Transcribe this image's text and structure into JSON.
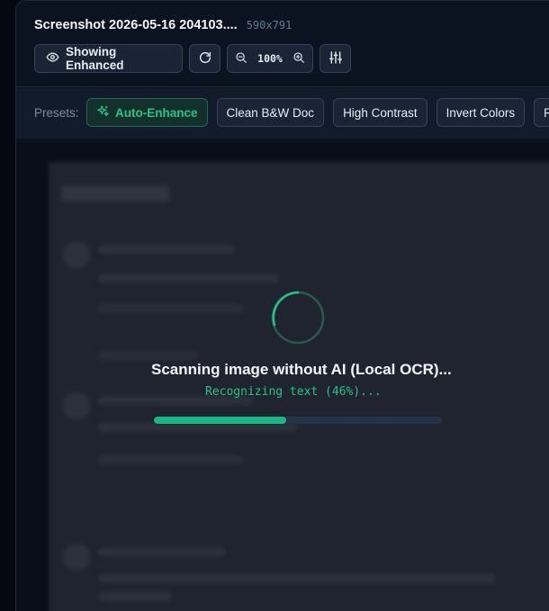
{
  "header": {
    "title": "Screenshot 2026-05-16 204103....",
    "dimensions": "590x791"
  },
  "toolbar": {
    "view_toggle_label": "Showing Enhanced",
    "zoom_value": "100%"
  },
  "presets": {
    "label": "Presets:",
    "items": [
      {
        "label": "Auto-Enhance",
        "active": true
      },
      {
        "label": "Clean B&W Doc",
        "active": false
      },
      {
        "label": "High Contrast",
        "active": false
      },
      {
        "label": "Invert Colors",
        "active": false
      },
      {
        "label": "R",
        "active": false
      }
    ]
  },
  "scan": {
    "title": "Scanning image without AI (Local OCR)...",
    "status": "Recognizing text (46%)...",
    "progress": 0.46
  },
  "colors": {
    "accent": "#22c58a",
    "background": "#0b1220"
  }
}
